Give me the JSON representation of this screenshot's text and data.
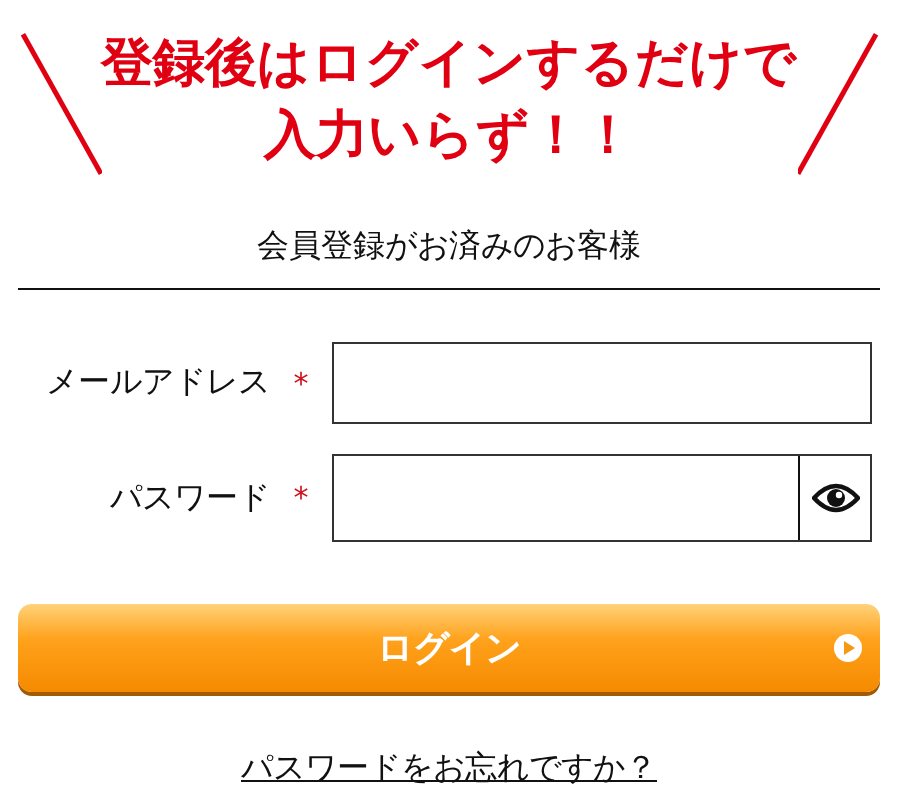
{
  "headline": [
    "登録後はログインするだけで",
    "入力いらず！！"
  ],
  "section_title": "会員登録がお済みのお客様",
  "fields": [
    {
      "label": "メールアドレス",
      "required_mark": "*",
      "kind": "text"
    },
    {
      "label": "パスワード",
      "required_mark": "*",
      "kind": "password"
    }
  ],
  "login_button": "ログイン",
  "forgot_link": "パスワードをお忘れですか？"
}
